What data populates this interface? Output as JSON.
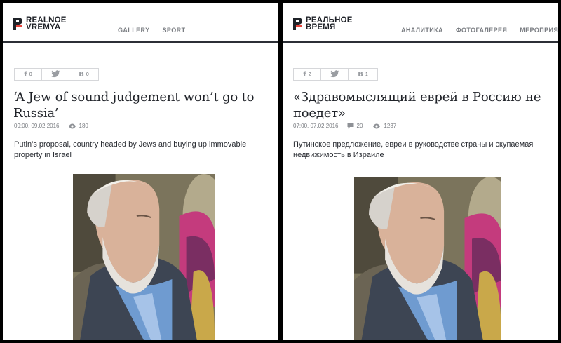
{
  "panels": {
    "en": {
      "logo": {
        "line1": "REALNOE",
        "line2": "VREMYA"
      },
      "nav": [
        "GALLERY",
        "SPORT"
      ],
      "share": {
        "facebook_count": "0",
        "vk_count": "0"
      },
      "headline": "‘A Jew of sound judgement won’t go to Russia’",
      "date": "09:00, 09.02.2016",
      "views": "180",
      "lead": "Putin’s proposal, country headed by Jews and buying up immovable property in Israel"
    },
    "ru": {
      "logo": {
        "line1": "РЕАЛЬНОЕ",
        "line2": "ВРЕМЯ"
      },
      "nav": [
        "АНАЛИТИКА",
        "ФОТОГАЛЕРЕЯ",
        "МЕРОПРИЯТ"
      ],
      "share": {
        "facebook_count": "2",
        "vk_count": "1"
      },
      "headline": "«Здравомыслящий еврей в Россию не поедет»",
      "date": "07:00, 07.02.2016",
      "comments": "20",
      "views": "1237",
      "lead": "Путинское предложение, евреи в руководстве страны и скупаемая недвижимость в Израиле"
    }
  },
  "icons": {
    "facebook": "facebook-icon",
    "twitter": "twitter-icon",
    "vk": "vk-icon",
    "eye": "eye-icon",
    "comment": "comment-icon"
  },
  "colors": {
    "brand_red": "#e8423a",
    "text_dark": "#1f2228",
    "meta_gray": "#7a7d82"
  }
}
